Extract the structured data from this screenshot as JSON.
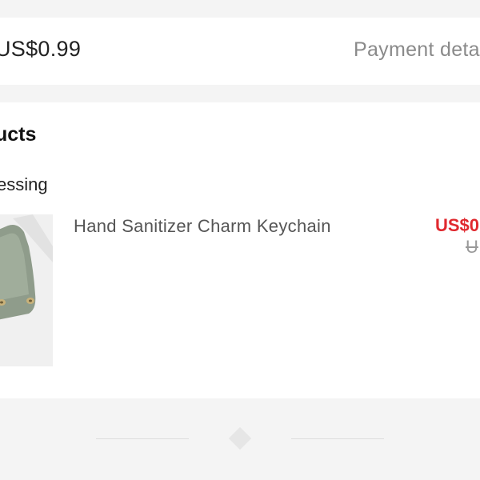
{
  "summary": {
    "total": "US$0.99",
    "payment_details_label": "Payment deta"
  },
  "products": {
    "title": "ucts",
    "status": "essing",
    "items": [
      {
        "name": "Hand Sanitizer Charm Keychain",
        "price": "US$0",
        "original_price": "U",
        "thumbnail_icon": "keychain-pouch-image"
      }
    ]
  },
  "colors": {
    "price_red": "#e0292f",
    "background": "#f4f4f4",
    "card": "#ffffff"
  }
}
